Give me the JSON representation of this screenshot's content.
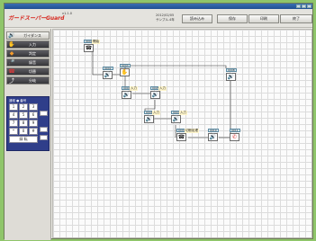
{
  "app": {
    "title": "",
    "version": "v1.1.0",
    "logo_text": "ガードスーパーGuard",
    "date": "2012/02/05",
    "subtitle": "サンプル.4年"
  },
  "header_buttons": [
    {
      "label": "読み込み"
    },
    {
      "label": "保存"
    },
    {
      "label": "印刷"
    },
    {
      "label": "終了"
    }
  ],
  "sidebar": {
    "items": [
      {
        "label": "ガイダンス",
        "icon": "speaker-icon"
      },
      {
        "label": "入力",
        "icon": "input-icon"
      },
      {
        "label": "判定",
        "icon": "judge-icon"
      },
      {
        "label": "録音",
        "icon": "microphone-icon"
      },
      {
        "label": "切替",
        "icon": "switch-icon"
      },
      {
        "label": "分岐",
        "icon": "branch-icon"
      }
    ]
  },
  "keypad": {
    "header": "通常 ● 番号",
    "keys": [
      "1",
      "2",
      "3",
      "4",
      "5",
      "6",
      "7",
      "8",
      "9",
      "*",
      "0",
      "#"
    ],
    "bottom_label": "録 転"
  },
  "flow": {
    "nodes": [
      {
        "tag": "0001",
        "label": "開始",
        "icon": "phone-icon",
        "icon_glyph": "☎"
      },
      {
        "tag": "0002",
        "label": "",
        "icon": "speaker-icon",
        "icon_glyph": "🔊"
      },
      {
        "tag": "0003",
        "label": "",
        "icon": "input-icon",
        "icon_glyph": "✋"
      },
      {
        "tag": "0004",
        "label": "入力",
        "icon": "speaker-icon",
        "icon_glyph": "🔊"
      },
      {
        "tag": "0005",
        "label": "入力",
        "icon": "speaker-icon",
        "icon_glyph": "🔊"
      },
      {
        "tag": "0006",
        "label": "入力",
        "icon": "speaker-icon",
        "icon_glyph": "🔊"
      },
      {
        "tag": "0007",
        "label": "入力",
        "icon": "speaker-icon",
        "icon_glyph": "🔊"
      },
      {
        "tag": "0008",
        "label": "",
        "icon": "speaker-icon",
        "icon_glyph": "🔊"
      },
      {
        "tag": "0009",
        "label": "切断処理",
        "icon": "phone-icon",
        "icon_glyph": "☎"
      },
      {
        "tag": "0010",
        "label": "",
        "icon": "speaker-icon",
        "icon_glyph": "🔊"
      },
      {
        "tag": "0011",
        "label": "",
        "icon": "hangup-icon",
        "icon_glyph": "✆"
      }
    ]
  }
}
